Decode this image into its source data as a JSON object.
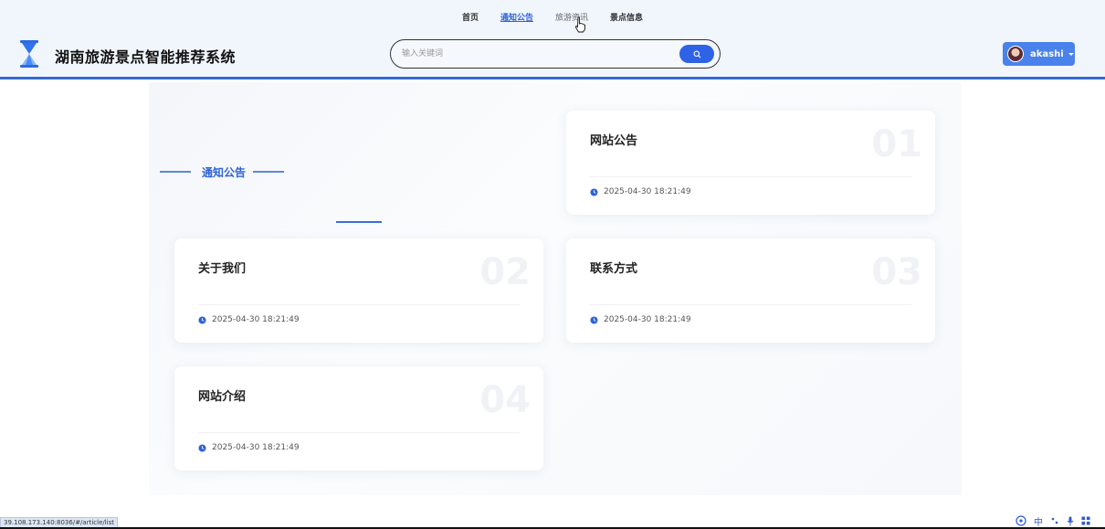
{
  "nav": {
    "items": [
      "首页",
      "通知公告",
      "旅游资讯",
      "景点信息"
    ]
  },
  "site": {
    "title": "湖南旅游景点智能推荐系统"
  },
  "search": {
    "placeholder": "输入关键词"
  },
  "user": {
    "name": "akashi"
  },
  "section": {
    "title": "通知公告"
  },
  "cards": [
    {
      "title": "网站公告",
      "num": "01",
      "time": "2025-04-30 18:21:49"
    },
    {
      "title": "关于我们",
      "num": "02",
      "time": "2025-04-30 18:21:49"
    },
    {
      "title": "联系方式",
      "num": "03",
      "time": "2025-04-30 18:21:49"
    },
    {
      "title": "网站介绍",
      "num": "04",
      "time": "2025-04-30 18:21:49"
    }
  ],
  "status": {
    "url": "39.108.173.140:8036/#/article/list"
  },
  "tray": {
    "lang": "中"
  },
  "colors": {
    "accent": "#2e63d9",
    "header_bg": "#f1f6fc",
    "search_button": "#2e63e6",
    "user_button": "#4a82ec"
  }
}
